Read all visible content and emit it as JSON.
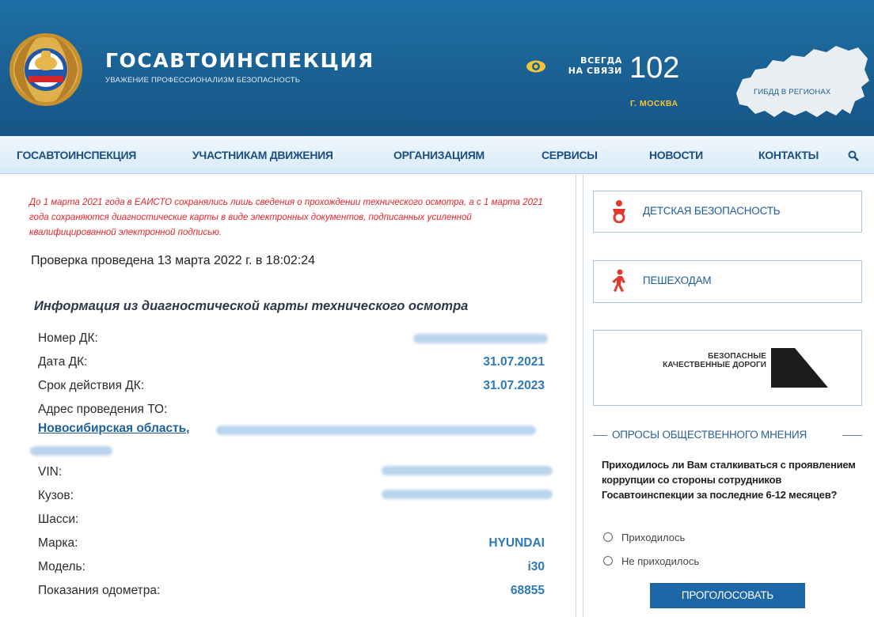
{
  "header": {
    "brand_title": "ГОСАВТОИНСПЕКЦИЯ",
    "brand_subtitle": "УВАЖЕНИЕ ПРОФЕССИОНАЛИЗМ БЕЗОПАСНОСТЬ",
    "phone_caption_line1": "ВСЕГДА",
    "phone_caption_line2": "НА СВЯЗИ",
    "phone_number": "102",
    "phone_city": "Г. МОСКВА",
    "map_label": "ГИБДД В РЕГИОНАХ",
    "icons": [
      "emblem-icon",
      "eye-icon",
      "russia-map-icon"
    ]
  },
  "nav": {
    "items": [
      "ГОСАВТОИНСПЕКЦИЯ",
      "УЧАСТНИКАМ ДВИЖЕНИЯ",
      "ОРГАНИЗАЦИЯМ",
      "СЕРВИСЫ",
      "НОВОСТИ",
      "КОНТАКТЫ"
    ],
    "search_icon": "search-icon"
  },
  "main": {
    "notice": "До 1 марта 2021 года в ЕАИСТО сохранялись лишь сведения о прохождении технического осмотра, а с 1 марта 2021 года сохраняются диагностические карты в виде электронных документов, подписанных усиленной квалифицированной электронной подписью.",
    "check_line": "Проверка проведена 13 марта 2022 г. в 18:02:24",
    "info_title": "Информация из диагностической карты технического осмотра",
    "rows": {
      "dk_number_label": "Номер ДК:",
      "dk_date_label": "Дата ДК:",
      "dk_date_value": "31.07.2021",
      "dk_valid_label": "Срок действия ДК:",
      "dk_valid_value": "31.07.2023",
      "address_label": "Адрес проведения ТО:",
      "address_value": "Новосибирская область,",
      "vin_label": "VIN:",
      "body_label": "Кузов:",
      "chassis_label": "Шасси:",
      "brand_label": "Марка:",
      "brand_value": "HYUNDAI",
      "model_label": "Модель:",
      "model_value": "i30",
      "odometer_label": "Показания одометра:",
      "odometer_value": "68855"
    }
  },
  "sidebar": {
    "child_safety": "ДЕТСКАЯ БЕЗОПАСНОСТЬ",
    "pedestrians": "ПЕШЕХОДАМ",
    "quality_roads_line1": "БЕЗОПАСНЫЕ",
    "quality_roads_line2": "КАЧЕСТВЕННЫЕ ДОРОГИ",
    "poll": {
      "legend": "ОПРОСЫ ОБЩЕСТВЕННОГО МНЕНИЯ",
      "question": "Приходилось ли Вам сталкиваться с проявлением коррупции со стороны сотрудников Госавтоинспекции за последние 6-12 месяцев?",
      "option_yes": "Приходилось",
      "option_no": "Не приходилось",
      "vote_button": "ПРОГОЛОСОВАТЬ"
    }
  },
  "colors": {
    "header_blue": "#1a5f91",
    "nav_text": "#1b4f82",
    "notice_red": "#e8232a",
    "value_blue": "#2d79b8",
    "button_blue": "#1e67a6",
    "city_yellow": "#f3c33a"
  }
}
